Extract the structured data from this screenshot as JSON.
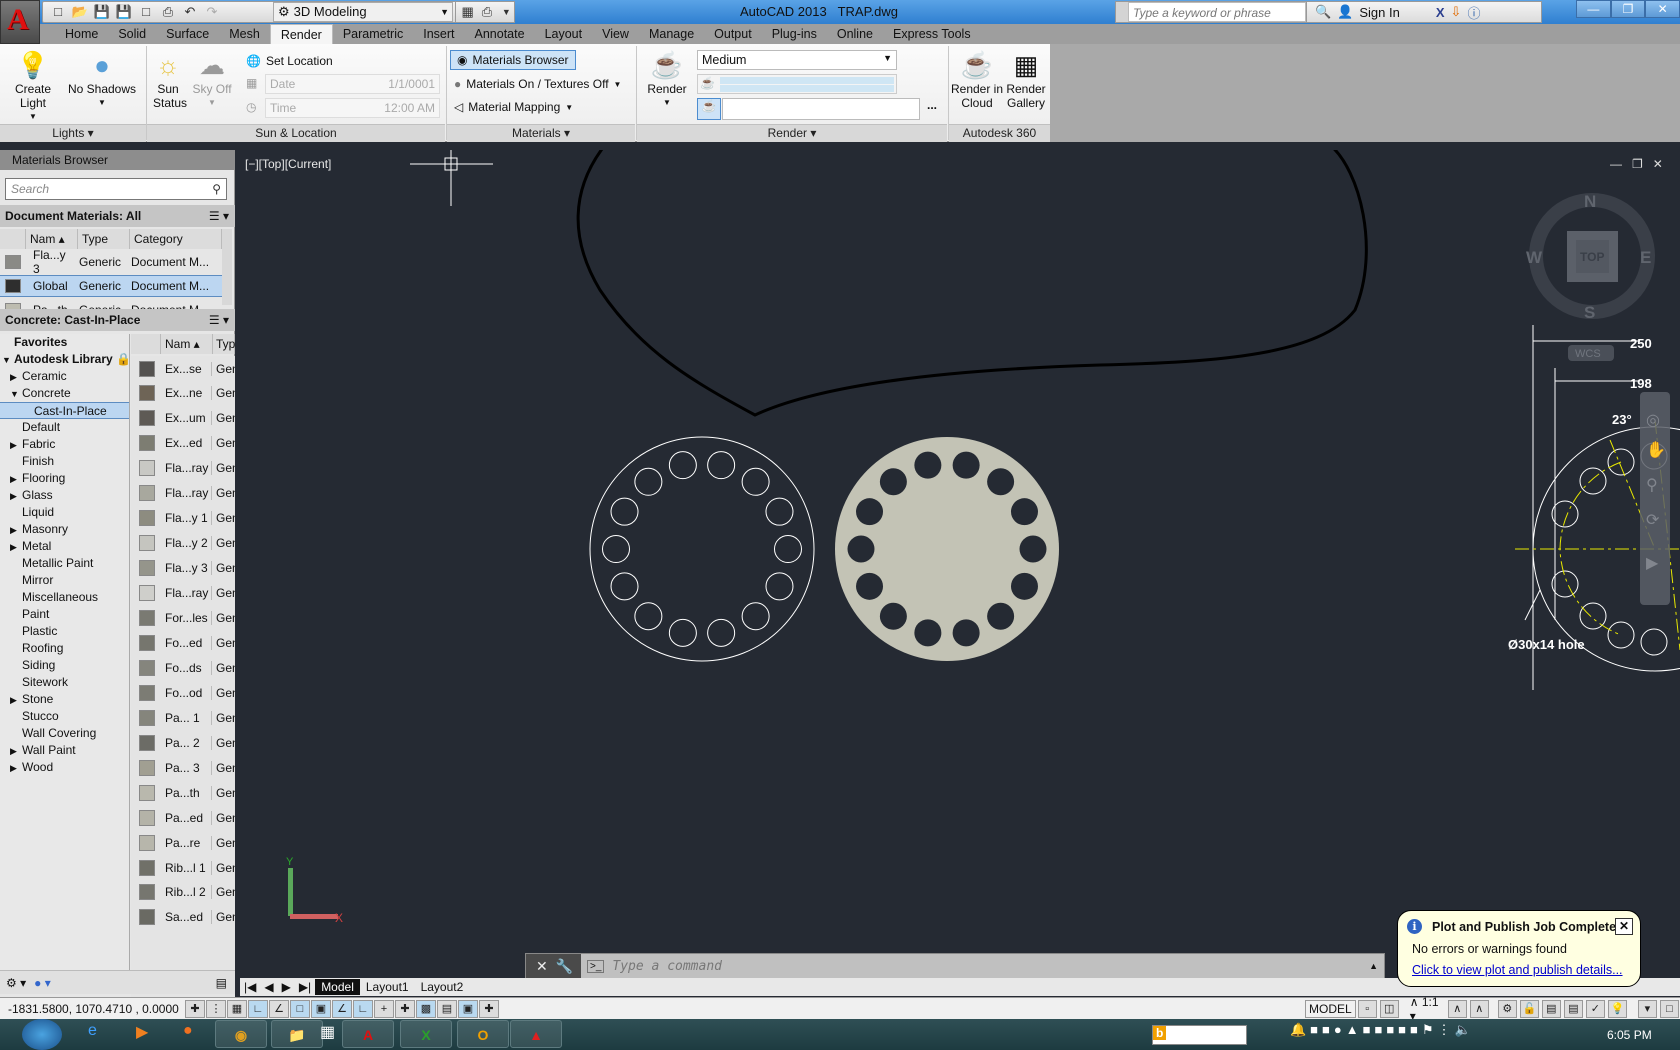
{
  "app": {
    "title": "AutoCAD 2013",
    "file": "TRAP.dwg",
    "workspace": "3D Modeling"
  },
  "search": {
    "placeholder": "Type a keyword or phrase"
  },
  "account": {
    "sign_in": "Sign In"
  },
  "ribbon_tabs": [
    "Home",
    "Solid",
    "Surface",
    "Mesh",
    "Render",
    "Parametric",
    "Insert",
    "Annotate",
    "Layout",
    "View",
    "Manage",
    "Output",
    "Plug-ins",
    "Online",
    "Express Tools"
  ],
  "active_tab": "Render",
  "ribbon": {
    "lights": {
      "title": "Lights",
      "create_light": "Create Light",
      "no_shadows": "No Shadows"
    },
    "sun": {
      "title": "Sun & Location",
      "sun_status": "Sun Status",
      "sky_off": "Sky Off",
      "set_location": "Set Location",
      "date_label": "Date",
      "date_value": "1/1/0001",
      "time_label": "Time",
      "time_value": "12:00 AM"
    },
    "materials": {
      "title": "Materials",
      "browser": "Materials Browser",
      "on_textures": "Materials On / Textures Off",
      "mapping": "Material Mapping"
    },
    "render": {
      "title": "Render",
      "render_btn": "Render",
      "quality": "Medium",
      "output_path": "",
      "browse": "..."
    },
    "a360": {
      "title": "Autodesk 360",
      "cloud": "Render in Cloud",
      "gallery": "Render Gallery"
    }
  },
  "palette": {
    "title": "Materials Browser",
    "search_placeholder": "Search",
    "doc_header": "Document Materials: All",
    "doc_columns": [
      "Nam",
      "Type",
      "Category"
    ],
    "doc_rows": [
      {
        "name": "Fla...y 3",
        "type": "Generic",
        "category": "Document M...",
        "color": "#8a8a86"
      },
      {
        "name": "Global",
        "type": "Generic",
        "category": "Document M...",
        "color": "#2e2e2e",
        "selected": true
      },
      {
        "name": "Pa...th",
        "type": "Generic",
        "category": "Document M...",
        "color": "#bdbcb0"
      }
    ],
    "lib_header": "Concrete: Cast-In-Place",
    "tree": {
      "favorites": "Favorites",
      "library": "Autodesk Library",
      "items": [
        {
          "label": "Ceramic",
          "exp": "collapsed"
        },
        {
          "label": "Concrete",
          "exp": "expanded"
        },
        {
          "label": "Cast-In-Place",
          "exp": "child",
          "selected": true
        },
        {
          "label": "Default",
          "exp": "none"
        },
        {
          "label": "Fabric",
          "exp": "collapsed"
        },
        {
          "label": "Finish",
          "exp": "none"
        },
        {
          "label": "Flooring",
          "exp": "collapsed"
        },
        {
          "label": "Glass",
          "exp": "collapsed"
        },
        {
          "label": "Liquid",
          "exp": "none"
        },
        {
          "label": "Masonry",
          "exp": "collapsed"
        },
        {
          "label": "Metal",
          "exp": "collapsed"
        },
        {
          "label": "Metallic Paint",
          "exp": "none"
        },
        {
          "label": "Mirror",
          "exp": "none"
        },
        {
          "label": "Miscellaneous",
          "exp": "none"
        },
        {
          "label": "Paint",
          "exp": "none"
        },
        {
          "label": "Plastic",
          "exp": "none"
        },
        {
          "label": "Roofing",
          "exp": "none"
        },
        {
          "label": "Siding",
          "exp": "none"
        },
        {
          "label": "Sitework",
          "exp": "none"
        },
        {
          "label": "Stone",
          "exp": "collapsed"
        },
        {
          "label": "Stucco",
          "exp": "none"
        },
        {
          "label": "Wall Covering",
          "exp": "none"
        },
        {
          "label": "Wall Paint",
          "exp": "collapsed"
        },
        {
          "label": "Wood",
          "exp": "collapsed"
        }
      ]
    },
    "lib_columns": [
      "Nam",
      "Typ"
    ],
    "lib_rows": [
      {
        "name": "Ex...se",
        "type": "Gen",
        "color": "#545250"
      },
      {
        "name": "Ex...ne",
        "type": "Gen",
        "color": "#6e6456"
      },
      {
        "name": "Ex...um",
        "type": "Gen",
        "color": "#5e5a55"
      },
      {
        "name": "Ex...ed",
        "type": "Gen",
        "color": "#7d7d72"
      },
      {
        "name": "Fla...ray",
        "type": "Gen",
        "color": "#c8c8c4"
      },
      {
        "name": "Fla...ray",
        "type": "Gen",
        "color": "#a8a89e"
      },
      {
        "name": "Fla...y 1",
        "type": "Gen",
        "color": "#8d8c80"
      },
      {
        "name": "Fla...y 2",
        "type": "Gen",
        "color": "#c5c5bf"
      },
      {
        "name": "Fla...y 3",
        "type": "Gen",
        "color": "#95958b"
      },
      {
        "name": "Fla...ray",
        "type": "Gen",
        "color": "#cfcfcb"
      },
      {
        "name": "For...les",
        "type": "Gen",
        "color": "#7a7a72"
      },
      {
        "name": "Fo...ed",
        "type": "Gen",
        "color": "#76766e"
      },
      {
        "name": "Fo...ds",
        "type": "Gen",
        "color": "#85857d"
      },
      {
        "name": "Fo...od",
        "type": "Gen",
        "color": "#7c7c74"
      },
      {
        "name": "Pa... 1",
        "type": "Gen",
        "color": "#85857c"
      },
      {
        "name": "Pa... 2",
        "type": "Gen",
        "color": "#6c6c66"
      },
      {
        "name": "Pa... 3",
        "type": "Gen",
        "color": "#a19f92"
      },
      {
        "name": "Pa...th",
        "type": "Gen",
        "color": "#b9b8ad"
      },
      {
        "name": "Pa...ed",
        "type": "Gen",
        "color": "#b4b3a8"
      },
      {
        "name": "Pa...re",
        "type": "Gen",
        "color": "#b7b6ab"
      },
      {
        "name": "Rib...l 1",
        "type": "Gen",
        "color": "#707068"
      },
      {
        "name": "Rib...l 2",
        "type": "Gen",
        "color": "#76766f"
      },
      {
        "name": "Sa...ed",
        "type": "Gen",
        "color": "#6a6a63"
      }
    ]
  },
  "viewport": {
    "label": "[−][Top][Current]",
    "viewcube": {
      "top": "TOP",
      "n": "N",
      "s": "S",
      "e": "E",
      "w": "W",
      "wcs": "WCS"
    },
    "dims": {
      "d1": "250",
      "d2": "198",
      "angle": "23°",
      "hole": "Ø30x14 hole"
    },
    "ucs": {
      "x": "X",
      "y": "Y"
    }
  },
  "layout_tabs": [
    "Model",
    "Layout1",
    "Layout2"
  ],
  "command": {
    "placeholder": "Type a command"
  },
  "status": {
    "coords": "-1831.5800, 1070.4710 , 0.0000",
    "model": "MODEL",
    "scale": "1:1"
  },
  "balloon": {
    "title": "Plot and Publish Job Complete",
    "message": "No errors or warnings found",
    "link": "Click to view plot and publish details..."
  },
  "taskbar": {
    "clock": "6:05 PM"
  },
  "colors": {
    "viewport_bg": "#252a33",
    "accent": "#4c8ccf",
    "filled_disc": "#c3c3b5",
    "dim_yellow": "#e8e800"
  }
}
